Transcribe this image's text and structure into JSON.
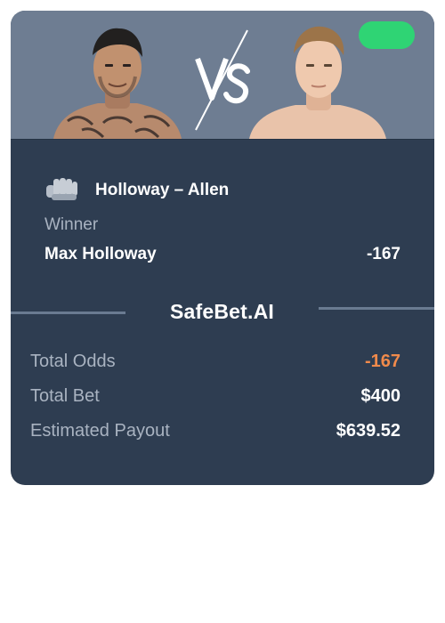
{
  "colors": {
    "card_background": "#2e3d51",
    "hero_background": "#6e7d92",
    "status_pill": "#2fd474",
    "odds_accent": "#f08a4b",
    "muted_text": "#a9b3c1",
    "divider": "#6a7b91"
  },
  "hero": {
    "left_fighter_image": "fighter-portrait",
    "right_fighter_image": "fighter-portrait",
    "vs_mark": "vs-icon"
  },
  "bet": {
    "icon": "fist-icon",
    "matchup": "Holloway – Allen",
    "market": "Winner",
    "selection": "Max Holloway",
    "selection_odds": "-167"
  },
  "brand": "SafeBet.AI",
  "summary": [
    {
      "label": "Total Odds",
      "value": "-167"
    },
    {
      "label": "Total Bet",
      "value": "$400"
    },
    {
      "label": "Estimated Payout",
      "value": "$639.52"
    }
  ]
}
